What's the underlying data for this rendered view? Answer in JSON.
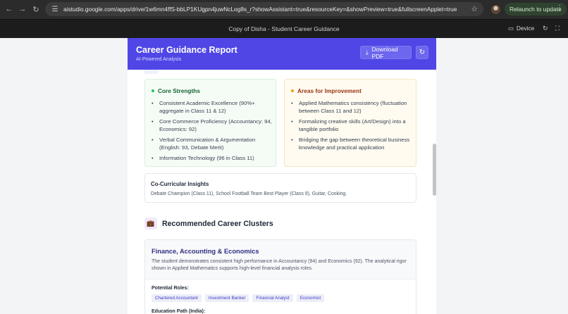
{
  "browser": {
    "url": "aistudio.google.com/apps/drive/1w6mn4ffS-bbLP1KUgpn4juwNcLog8s_r?showAssistant=true&resourceKey=&showPreview=true&fullscreenApplet=true",
    "relaunch_label": "Relaunch to update"
  },
  "appbar": {
    "title": "Copy of Disha - Student Career Guidance",
    "device_label": "Device"
  },
  "report": {
    "title": "Career Guidance Report",
    "subtitle": "AI-Powered Analysis",
    "download_label": "Download PDF"
  },
  "strengths": {
    "heading": "Core Strengths",
    "color": "#16a34a",
    "items": [
      "Consistent Academic Excellence (90%+ aggregate in Class 11 & 12)",
      "Core Commerce Proficiency (Accountancy: 94, Economics: 92)",
      "Verbal Communication & Argumentation (English: 93, Debate Merit)",
      "Information Technology (96 in Class 11)"
    ]
  },
  "improvement": {
    "heading": "Areas for Improvement",
    "color": "#b45309",
    "items": [
      "Applied Mathematics consistency (fluctuation between Class 11 and 12)",
      "Formalizing creative skills (Art/Design) into a tangible portfolio",
      "Bridging the gap between theoretical business knowledge and practical application"
    ]
  },
  "cocurricular": {
    "title": "Co-Curricular Insights",
    "text": "Debate Champion (Class 11), School Football Team Best Player (Class 9), Guitar, Cooking."
  },
  "recommended": {
    "title": "Recommended Career Clusters"
  },
  "cluster": {
    "title": "Finance, Accounting & Economics",
    "description": "The student demonstrates consistent high performance in Accountancy (94) and Economics (92). The analytical rigor shown in Applied Mathematics supports high-level financial analysis roles.",
    "roles_label": "Potential Roles:",
    "roles": [
      "Chartered Accountant",
      "Investment Banker",
      "Financial Analyst",
      "Economist"
    ],
    "education_label": "Education Path (India):"
  },
  "theme": {
    "accent": "#4f46e5"
  }
}
